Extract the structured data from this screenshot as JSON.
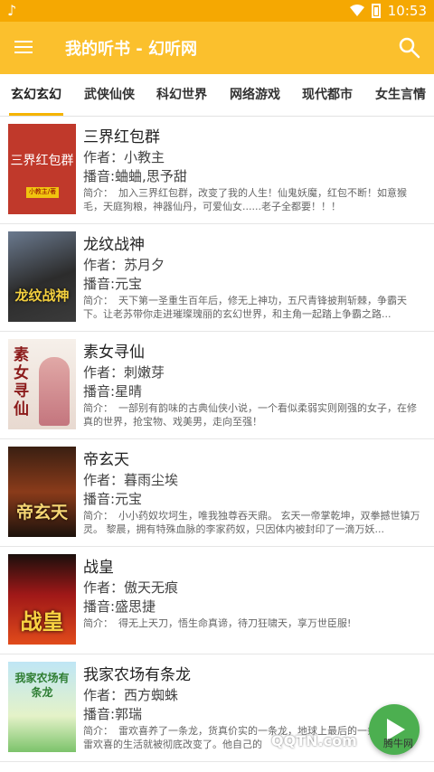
{
  "status_bar": {
    "time": "10:53",
    "notification_icon": "music-note-icon"
  },
  "app_bar": {
    "title": "我的听书 - 幻听网",
    "menu_icon": "hamburger-menu-icon",
    "search_icon": "search-icon"
  },
  "tabs": [
    {
      "label": "玄幻玄幻",
      "active": true
    },
    {
      "label": "武侠仙侠",
      "active": false
    },
    {
      "label": "科幻世界",
      "active": false
    },
    {
      "label": "网络游戏",
      "active": false
    },
    {
      "label": "现代都市",
      "active": false
    },
    {
      "label": "女生言情",
      "active": false
    }
  ],
  "books": [
    {
      "title": "三界红包群",
      "author": "作者：小教主",
      "narrator": "播音:蛐蛐,思予甜",
      "desc_label": "简介：",
      "desc": "加入三界红包群，改变了我的人生！仙鬼妖魔，红包不断！如意猴毛，天庭狗粮，神器仙丹，可爱仙女......老子全都要！！！",
      "cover_text": "三界红包群",
      "cover_sub": "小教主/著"
    },
    {
      "title": "龙纹战神",
      "author": "作者：苏月夕",
      "narrator": "播音:元宝",
      "desc_label": "简介：",
      "desc": "天下第一圣重生百年后，修无上神功，五尺青锋披荆斩棘，争霸天下。让老苏带你走进璀璨瑰丽的玄幻世界，和主角一起踏上争霸之路...",
      "cover_text": "龙纹战神",
      "cover_sub": ""
    },
    {
      "title": "素女寻仙",
      "author": "作者：刺嫩芽",
      "narrator": "播音:星晴",
      "desc_label": "简介：",
      "desc": "一部别有韵味的古典仙侠小说，一个看似柔弱实则刚强的女子，在修真的世界，抢宝物、戏美男，走向至强！",
      "cover_text": "素女寻仙",
      "cover_sub": ""
    },
    {
      "title": "帝玄天",
      "author": "作者：暮雨尘埃",
      "narrator": "播音:元宝",
      "desc_label": "简介：",
      "desc": "小小药奴坎坷生，唯我独尊吞天鼎。 玄天一帝掌乾坤，双拳撼世镇万灵。 黎晨，拥有特殊血脉的李家药奴，只因体内被封印了一滴万妖...",
      "cover_text": "帝玄天",
      "cover_sub": ""
    },
    {
      "title": "战皇",
      "author": "作者：傲天无痕",
      "narrator": "播音:盛思捷",
      "desc_label": "简介：",
      "desc": "得无上天刀，悟生命真谛，待刀狂啸天，享万世臣服!",
      "cover_text": "战皇",
      "cover_sub": ""
    },
    {
      "title": "我家农场有条龙",
      "author": "作者：西方蜘蛛",
      "narrator": "播音:郭瑞",
      "desc_label": "简介：",
      "desc": "雷欢喜养了一条龙，货真价实的一条龙，地球上最后的一条龙。于是雷欢喜的生活就被彻底改变了。他自己的",
      "cover_text": "我家农场有条龙",
      "cover_sub": ""
    }
  ],
  "watermark": {
    "logo": "QQTN.com",
    "text": "腾牛网"
  },
  "colors": {
    "status_bar": "#f5a802",
    "app_bar": "#fbc02d",
    "tab_indicator": "#f5b400",
    "fab": "#4caf50"
  }
}
